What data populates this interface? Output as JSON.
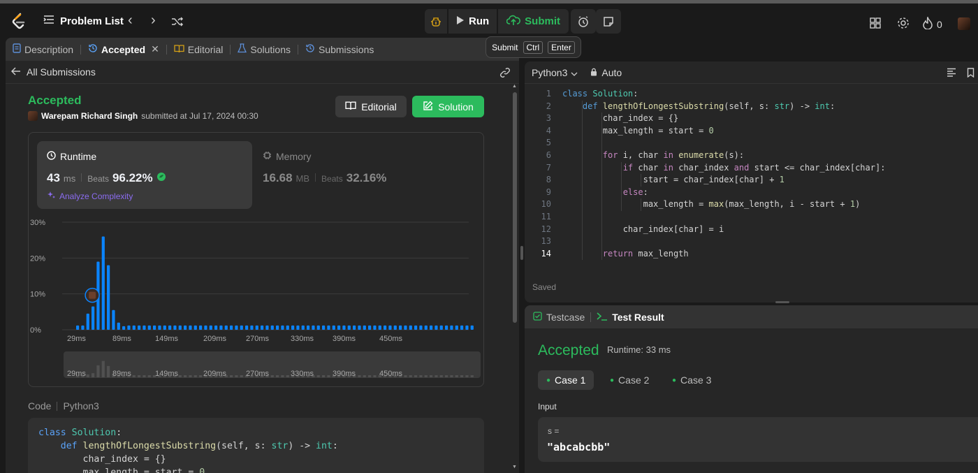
{
  "topbar": {
    "problem_list": "Problem List",
    "run_label": "Run",
    "submit_label": "Submit",
    "streak_count": "0"
  },
  "tooltip": {
    "label": "Submit",
    "key1": "Ctrl",
    "key2": "Enter"
  },
  "tabs": [
    {
      "label": "Description"
    },
    {
      "label": "Accepted"
    },
    {
      "label": "Editorial"
    },
    {
      "label": "Solutions"
    },
    {
      "label": "Submissions"
    }
  ],
  "submission": {
    "back_label": "All Submissions",
    "status": "Accepted",
    "user": "Warepam Richard Singh",
    "submitted_text": "submitted at Jul 17, 2024 00:30",
    "editorial_button": "Editorial",
    "solution_button": "Solution"
  },
  "stats": {
    "runtime_label": "Runtime",
    "runtime_value": "43",
    "runtime_unit": "ms",
    "beats_label": "Beats",
    "runtime_beats": "96.22%",
    "analyze_label": "Analyze Complexity",
    "memory_label": "Memory",
    "memory_value": "16.68",
    "memory_unit": "MB",
    "memory_beats": "32.16%"
  },
  "chart_data": {
    "type": "bar",
    "ytick_labels": [
      "30%",
      "20%",
      "10%",
      "0%"
    ],
    "ylim": [
      0,
      30
    ],
    "xtick_labels": [
      "29ms",
      "89ms",
      "149ms",
      "209ms",
      "270ms",
      "330ms",
      "390ms",
      "450ms"
    ],
    "values": [
      1.2,
      1.2,
      4.5,
      6.5,
      19,
      26,
      18,
      5.5,
      2,
      1,
      1.2,
      1.2,
      1.2,
      1.2,
      1.2,
      1.2,
      1.2,
      1.2,
      1.2,
      1.2,
      1.2,
      1.2,
      1.2,
      1.2,
      1.2,
      1.2,
      1.2,
      1.2,
      1.2,
      1.2,
      1.2,
      1.2,
      1.2,
      1.2,
      1.2,
      1.2,
      1.2,
      1.2,
      1.2,
      1.2,
      1.2,
      1.2,
      1.2,
      1.2,
      1.2,
      1.2,
      1.2,
      1.2,
      1.2,
      1.2,
      1.2,
      1.2,
      1.2,
      1.2,
      1.2,
      1.2,
      1.2,
      1.2,
      1.2,
      1.2,
      1.2,
      1.2,
      1.2,
      1.2,
      1.2,
      1.2,
      1.2,
      1.2,
      1.2,
      1.2,
      1.2,
      1.2,
      1.2,
      1.2,
      1.2,
      1.2,
      1.2,
      1.2
    ],
    "highlight_index": 3,
    "bar_color": "#0a84ff",
    "grid": true
  },
  "code_section": {
    "label": "Code",
    "language": "Python3",
    "lines": [
      "class Solution:",
      "    def lengthOfLongestSubstring(self, s: str) -> int:",
      "        char_index = {}",
      "        max_length = start = 0"
    ]
  },
  "editor": {
    "language": "Python3",
    "mode": "Auto",
    "saved_label": "Saved",
    "current_line": 14,
    "lines": [
      "class Solution:",
      "    def lengthOfLongestSubstring(self, s: str) -> int:",
      "        char_index = {}",
      "        max_length = start = 0",
      "",
      "        for i, char in enumerate(s):",
      "            if char in char_index and start <= char_index[char]:",
      "                start = char_index[char] + 1",
      "            else:",
      "                max_length = max(max_length, i - start + 1)",
      "",
      "            char_index[char] = i",
      "",
      "        return max_length"
    ]
  },
  "testpane": {
    "tab_testcase": "Testcase",
    "tab_result": "Test Result",
    "status": "Accepted",
    "runtime_text": "Runtime: 33 ms",
    "cases": [
      "Case 1",
      "Case 2",
      "Case 3"
    ],
    "input_label": "Input",
    "input_var": "s =",
    "input_value": "\"abcabcbb\""
  },
  "colors": {
    "accent_green": "#2cbb5d",
    "bar_blue": "#0a84ff",
    "bg": "#1a1a1a",
    "panel": "#262626"
  }
}
